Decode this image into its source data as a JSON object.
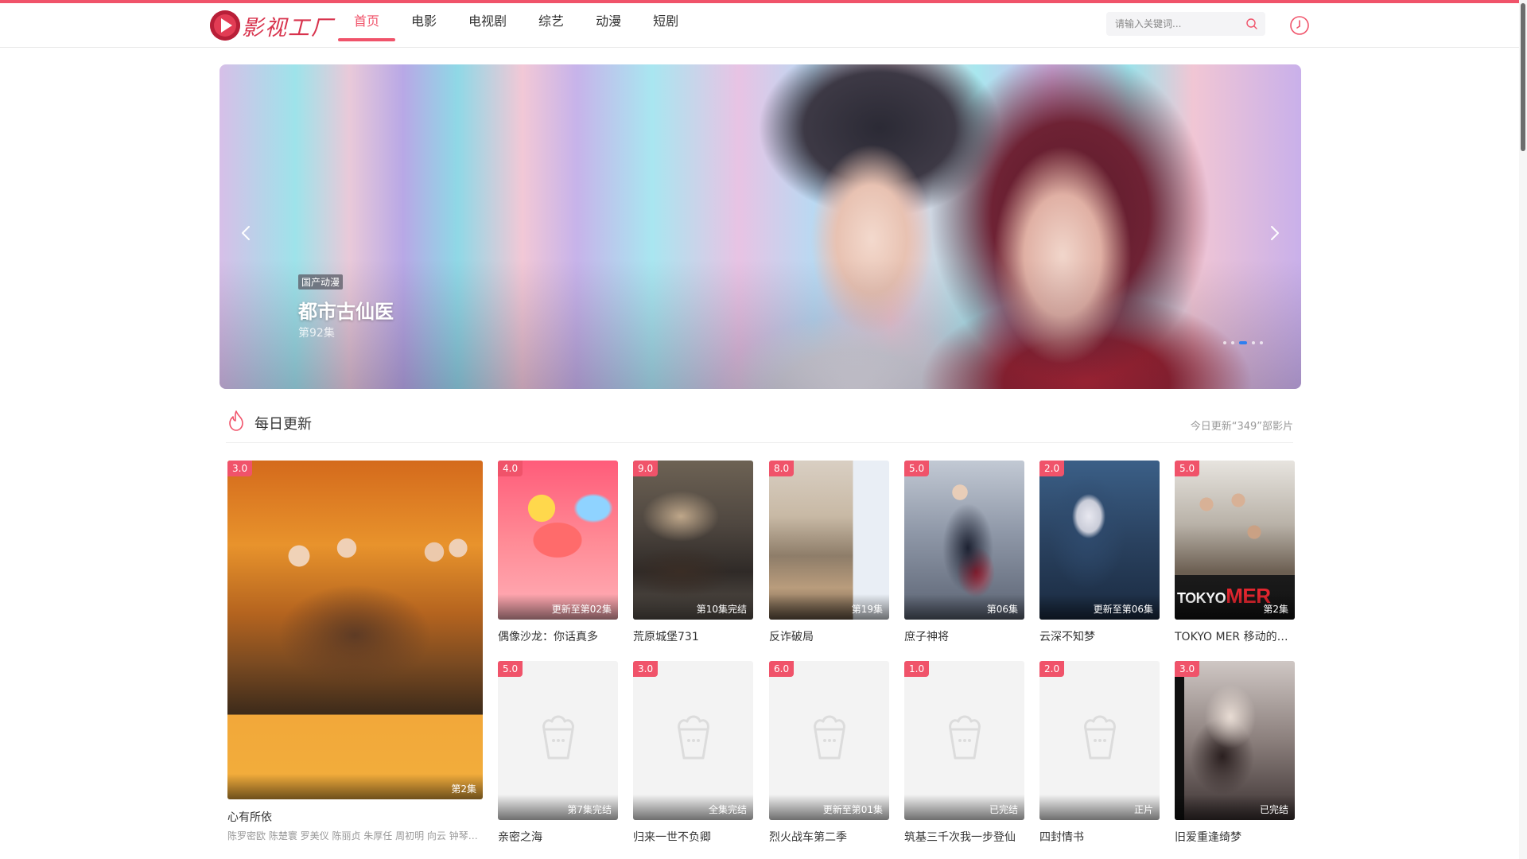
{
  "app": {
    "logo_text": "影视工厂"
  },
  "nav": [
    {
      "label": "首页",
      "active": true
    },
    {
      "label": "电影",
      "active": false
    },
    {
      "label": "电视剧",
      "active": false
    },
    {
      "label": "综艺",
      "active": false
    },
    {
      "label": "动漫",
      "active": false
    },
    {
      "label": "短剧",
      "active": false
    }
  ],
  "search": {
    "placeholder": "请输入关键词...",
    "icon": "search-icon"
  },
  "header_icons": {
    "history": "clock-icon"
  },
  "banner": {
    "tag": "国产动漫",
    "title": "都市古仙医",
    "subtitle": "第92集",
    "slides_total": 5,
    "active_slide": 3
  },
  "section": {
    "title": "每日更新",
    "stat": "今日更新“349”部影片",
    "icon": "fire-icon"
  },
  "featured": {
    "score": "3.0",
    "episode": "第2集",
    "title": "心有所依",
    "actors": "陈罗密欧 陈楚寰 罗美仪 陈丽贞 朱厚任 周初明 向云 钟琴 ..."
  },
  "row1": [
    {
      "score": "4.0",
      "episode": "更新至第02集",
      "title": "偶像沙龙：你话真多"
    },
    {
      "score": "9.0",
      "episode": "第10集完结",
      "title": "荒原城堡731"
    },
    {
      "score": "8.0",
      "episode": "第19集",
      "title": "反诈破局"
    },
    {
      "score": "5.0",
      "episode": "第06集",
      "title": "庶子神将"
    },
    {
      "score": "2.0",
      "episode": "更新至第06集",
      "title": "云深不知梦"
    },
    {
      "score": "5.0",
      "episode": "第2集",
      "title": "TOKYO MER 移动的急救室"
    }
  ],
  "row2": [
    {
      "score": "5.0",
      "episode": "第7集完结",
      "title": "亲密之海"
    },
    {
      "score": "3.0",
      "episode": "全集完结",
      "title": "归来一世不负卿"
    },
    {
      "score": "6.0",
      "episode": "更新至第01集",
      "title": "烈火战车第二季"
    },
    {
      "score": "1.0",
      "episode": "已完结",
      "title": "筑基三千次我一步登仙"
    },
    {
      "score": "2.0",
      "episode": "正片",
      "title": "四封情书"
    },
    {
      "score": "3.0",
      "episode": "已完结",
      "title": "旧爱重逢绮梦"
    }
  ],
  "poster_text": {
    "tokyo_a": "TOKYO",
    "tokyo_b": "MER"
  },
  "colors": {
    "accent": "#f0536a",
    "dot_active": "#2f7ff0"
  }
}
